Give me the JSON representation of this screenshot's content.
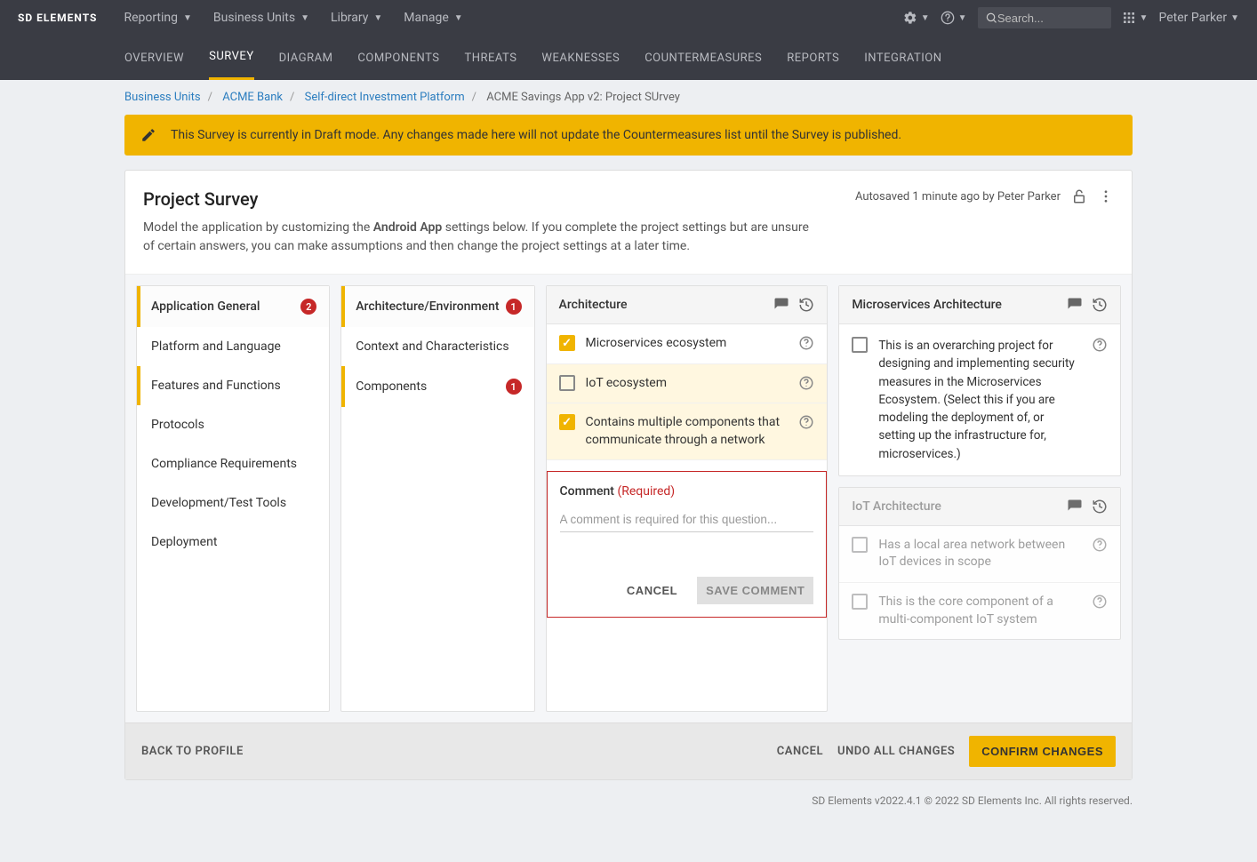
{
  "brand": "SD ELEMENTS",
  "topnav": [
    "Reporting",
    "Business Units",
    "Library",
    "Manage"
  ],
  "search_placeholder": "Search...",
  "user": "Peter Parker",
  "tabs": [
    "OVERVIEW",
    "SURVEY",
    "DIAGRAM",
    "COMPONENTS",
    "THREATS",
    "WEAKNESSES",
    "COUNTERMEASURES",
    "REPORTS",
    "INTEGRATION"
  ],
  "active_tab": "SURVEY",
  "breadcrumb": {
    "links": [
      "Business Units",
      "ACME Bank",
      "Self-direct Investment Platform"
    ],
    "current": "ACME Savings App v2: Project SUrvey"
  },
  "banner": "This Survey is currently in Draft mode. Any changes made here will not update the Countermeasures list until the Survey is published.",
  "survey": {
    "title": "Project Survey",
    "desc_pre": "Model the application by customizing the ",
    "desc_bold": "Android App",
    "desc_post": " settings below. If you complete the project settings but are unsure of certain answers, you can make assumptions and then change the project settings at a later time.",
    "autosave": "Autosaved 1 minute ago by Peter Parker"
  },
  "col1": {
    "items": [
      {
        "label": "Application General",
        "badge": "2",
        "active": true
      },
      {
        "label": "Platform and Language"
      },
      {
        "label": "Features and Functions",
        "sub": true
      },
      {
        "label": "Protocols"
      },
      {
        "label": "Compliance Requirements"
      },
      {
        "label": "Development/Test Tools"
      },
      {
        "label": "Deployment"
      }
    ]
  },
  "col2": {
    "items": [
      {
        "label": "Architecture/Environment",
        "badge": "1",
        "active": true
      },
      {
        "label": "Context and Characteristics"
      },
      {
        "label": "Components",
        "badge": "1",
        "sub": true
      }
    ]
  },
  "col3": {
    "title": "Architecture",
    "checks": [
      {
        "label": "Microservices ecosystem",
        "checked": true,
        "hl": false
      },
      {
        "label": "IoT ecosystem",
        "checked": false,
        "hl": true
      },
      {
        "label": "Contains multiple components that communicate through a network",
        "checked": true,
        "hl": true
      }
    ],
    "comment": {
      "title": "Comment",
      "required": "(Required)",
      "placeholder": "A comment is required for this question...",
      "cancel": "CANCEL",
      "save": "SAVE COMMENT"
    }
  },
  "col4": {
    "p1": {
      "title": "Microservices Architecture",
      "desc": "This is an overarching project for designing and implementing security measures in the Microservices Ecosystem. (Select this if you are modeling the deployment of, or setting up the infrastructure for, microservices.)"
    },
    "p2": {
      "title": "IoT Architecture",
      "r1": "Has a local area network between IoT devices in scope",
      "r2": "This is the core component of a multi-component IoT system"
    }
  },
  "footer": {
    "back": "BACK TO PROFILE",
    "cancel": "CANCEL",
    "undo": "UNDO ALL CHANGES",
    "confirm": "CONFIRM CHANGES"
  },
  "copyright": "SD Elements v2022.4.1 © 2022 SD Elements Inc. All rights reserved."
}
